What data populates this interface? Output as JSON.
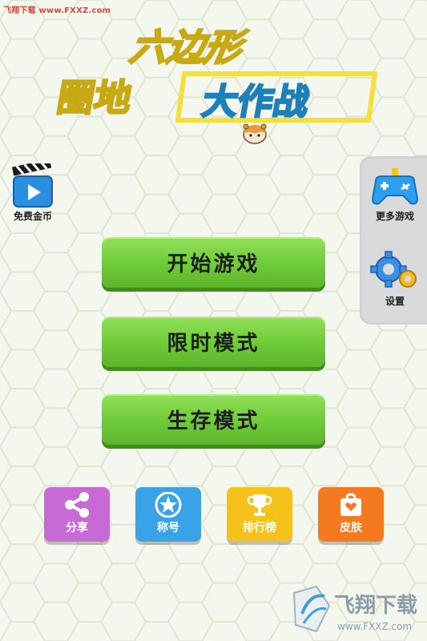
{
  "watermark_top": "飞翔下载 www.FXXZ.com",
  "logo": {
    "line1": "六边形",
    "line2": "圈地",
    "line3": "大作战"
  },
  "free_coins": {
    "label": "免费金币",
    "icon": "video-clapper-icon"
  },
  "side_panel": {
    "more_games": {
      "label": "更多游戏",
      "icon": "gamepad-icon"
    },
    "settings": {
      "label": "设置",
      "icon": "gears-icon"
    }
  },
  "menu": {
    "start_label": "开始游戏",
    "timed_label": "限时模式",
    "survival_label": "生存模式"
  },
  "tiles": [
    {
      "label": "分享",
      "icon": "share-icon",
      "color": "#c86ad6"
    },
    {
      "label": "称号",
      "icon": "star-icon",
      "color": "#3aa3e8"
    },
    {
      "label": "排行榜",
      "icon": "trophy-icon",
      "color": "#f5c21b"
    },
    {
      "label": "皮肤",
      "icon": "gift-box-icon",
      "color": "#f57a1f"
    }
  ],
  "watermark_bottom": {
    "brand": "飞翔下载",
    "url": "www.FXXZ.com"
  },
  "colors": {
    "background": "#f3f6ec",
    "hex_line": "#dfe8d2",
    "button_green": "#74cf3c",
    "logo_yellow": "#f7e04a",
    "logo_blue": "#4bb6ec"
  }
}
